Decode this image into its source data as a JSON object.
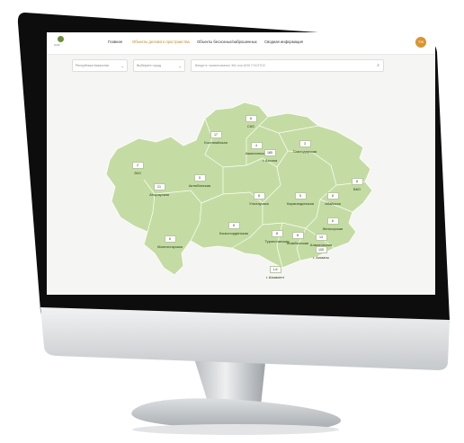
{
  "app": {
    "avatar_text": "ТЖ"
  },
  "nav": {
    "home": "Главная",
    "state_objects": "Объекты делового пространства",
    "ownerless": "Объекты бесхозных/заброшенных",
    "general": "Сводная информация"
  },
  "filters": {
    "country": "Республика Казахстан",
    "city_placeholder": "Выберите город",
    "search_placeholder": "Введите наименование ЖК или БИН ГОС/ПОС"
  },
  "regions": [
    {
      "name": "СКО",
      "count": "6"
    },
    {
      "name": "Костанайская",
      "count": "17"
    },
    {
      "name": "Акмолинская",
      "count": "4"
    },
    {
      "name": "Павлодарская",
      "count": "3"
    },
    {
      "name": "г. Астана",
      "count": "185"
    },
    {
      "name": "ЗКО",
      "count": "2"
    },
    {
      "name": "Актюбинская",
      "count": "5"
    },
    {
      "name": "Атырауская",
      "count": "21"
    },
    {
      "name": "Улытауская",
      "count": "8"
    },
    {
      "name": "Карагандинская",
      "count": "5"
    },
    {
      "name": "Абайская",
      "count": "8"
    },
    {
      "name": "ВКО",
      "count": "8"
    },
    {
      "name": "Мангистауская",
      "count": "6"
    },
    {
      "name": "Кызылординская",
      "count": "8"
    },
    {
      "name": "Жетысуская",
      "count": "6"
    },
    {
      "name": "Туркестанская",
      "count": "8"
    },
    {
      "name": "Жамбылская",
      "count": "8"
    },
    {
      "name": "Алматинская",
      "count": "13"
    },
    {
      "name": "г. Алматы",
      "count": "105"
    },
    {
      "name": "г. Шымкент",
      "count": "1.6"
    }
  ],
  "colors": {
    "map_fill": "#c4dca3",
    "map_border": "#ffffff",
    "accent": "#b8892c"
  }
}
